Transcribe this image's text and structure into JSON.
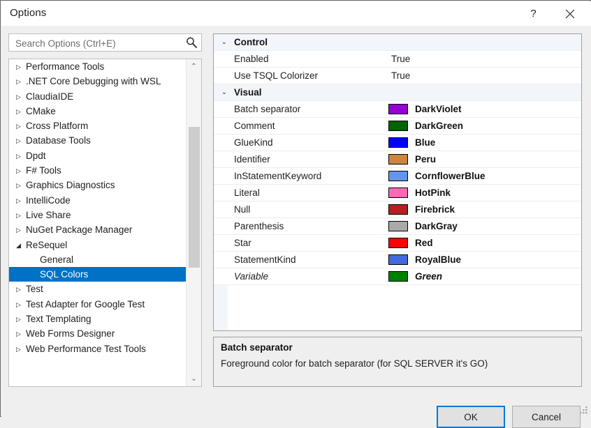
{
  "window": {
    "title": "Options",
    "help_label": "?",
    "close_label": "✕"
  },
  "search": {
    "placeholder": "Search Options (Ctrl+E)",
    "value": "",
    "icon": "search-icon"
  },
  "tree": {
    "items": [
      {
        "label": "Performance Tools",
        "arrow": "▷",
        "level": 0,
        "selected": false
      },
      {
        "label": ".NET Core Debugging with WSL",
        "arrow": "▷",
        "level": 0,
        "selected": false
      },
      {
        "label": "ClaudiaIDE",
        "arrow": "▷",
        "level": 0,
        "selected": false
      },
      {
        "label": "CMake",
        "arrow": "▷",
        "level": 0,
        "selected": false
      },
      {
        "label": "Cross Platform",
        "arrow": "▷",
        "level": 0,
        "selected": false
      },
      {
        "label": "Database Tools",
        "arrow": "▷",
        "level": 0,
        "selected": false
      },
      {
        "label": "Dpdt",
        "arrow": "▷",
        "level": 0,
        "selected": false
      },
      {
        "label": "F# Tools",
        "arrow": "▷",
        "level": 0,
        "selected": false
      },
      {
        "label": "Graphics Diagnostics",
        "arrow": "▷",
        "level": 0,
        "selected": false
      },
      {
        "label": "IntelliCode",
        "arrow": "▷",
        "level": 0,
        "selected": false
      },
      {
        "label": "Live Share",
        "arrow": "▷",
        "level": 0,
        "selected": false
      },
      {
        "label": "NuGet Package Manager",
        "arrow": "▷",
        "level": 0,
        "selected": false
      },
      {
        "label": "ReSequel",
        "arrow": "◢",
        "level": 0,
        "selected": false
      },
      {
        "label": "General",
        "arrow": "",
        "level": 1,
        "selected": false
      },
      {
        "label": "SQL Colors",
        "arrow": "",
        "level": 1,
        "selected": true
      },
      {
        "label": "Test",
        "arrow": "▷",
        "level": 0,
        "selected": false
      },
      {
        "label": "Test Adapter for Google Test",
        "arrow": "▷",
        "level": 0,
        "selected": false
      },
      {
        "label": "Text Templating",
        "arrow": "▷",
        "level": 0,
        "selected": false
      },
      {
        "label": "Web Forms Designer",
        "arrow": "▷",
        "level": 0,
        "selected": false
      },
      {
        "label": "Web Performance Test Tools",
        "arrow": "▷",
        "level": 0,
        "selected": false
      }
    ],
    "scrollbar": {
      "up_arrow": "⌃",
      "down_arrow": "⌄"
    }
  },
  "property_grid": {
    "chevron_expanded": "⌄",
    "rows": [
      {
        "kind": "category",
        "name": "Control"
      },
      {
        "kind": "property",
        "name": "Enabled",
        "value": "True",
        "swatch": null,
        "bold": false,
        "italic": false
      },
      {
        "kind": "property",
        "name": "Use TSQL Colorizer",
        "value": "True",
        "swatch": null,
        "bold": false,
        "italic": false
      },
      {
        "kind": "category",
        "name": "Visual"
      },
      {
        "kind": "property",
        "name": "Batch separator",
        "value": "DarkViolet",
        "swatch": "#9400D3",
        "bold": true,
        "italic": false
      },
      {
        "kind": "property",
        "name": "Comment",
        "value": "DarkGreen",
        "swatch": "#006400",
        "bold": true,
        "italic": false
      },
      {
        "kind": "property",
        "name": "GlueKind",
        "value": "Blue",
        "swatch": "#0000FF",
        "bold": true,
        "italic": false
      },
      {
        "kind": "property",
        "name": "Identifier",
        "value": "Peru",
        "swatch": "#CD853F",
        "bold": true,
        "italic": false
      },
      {
        "kind": "property",
        "name": "InStatementKeyword",
        "value": "CornflowerBlue",
        "swatch": "#6495ED",
        "bold": true,
        "italic": false
      },
      {
        "kind": "property",
        "name": "Literal",
        "value": "HotPink",
        "swatch": "#FF69B4",
        "bold": true,
        "italic": false
      },
      {
        "kind": "property",
        "name": "Null",
        "value": "Firebrick",
        "swatch": "#B22222",
        "bold": true,
        "italic": false
      },
      {
        "kind": "property",
        "name": "Parenthesis",
        "value": "DarkGray",
        "swatch": "#A9A9A9",
        "bold": true,
        "italic": false
      },
      {
        "kind": "property",
        "name": "Star",
        "value": "Red",
        "swatch": "#FF0000",
        "bold": true,
        "italic": false
      },
      {
        "kind": "property",
        "name": "StatementKind",
        "value": "RoyalBlue",
        "swatch": "#4169E1",
        "bold": true,
        "italic": false
      },
      {
        "kind": "property",
        "name": "Variable",
        "value": "Green",
        "swatch": "#008000",
        "bold": true,
        "italic": true
      }
    ]
  },
  "description": {
    "title": "Batch separator",
    "text": "Foreground color for batch separator (for SQL SERVER it's GO)"
  },
  "footer": {
    "ok_label": "OK",
    "cancel_label": "Cancel"
  },
  "colors": {
    "selection": "#0072c6",
    "focus_border": "#0078d7",
    "category_background": "#f2f6fb"
  }
}
